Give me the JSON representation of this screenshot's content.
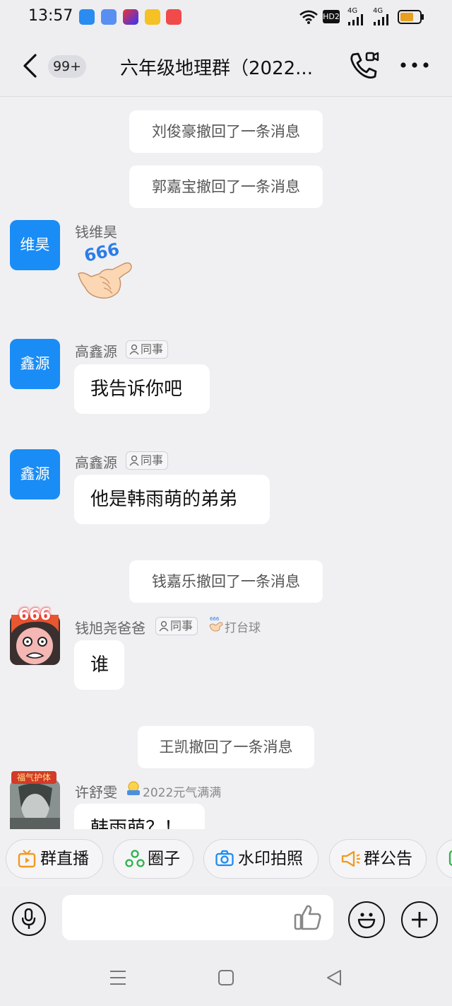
{
  "status_bar": {
    "time": "13:57",
    "hd_label": "HD2",
    "net1": "4G",
    "net2": "4G"
  },
  "header": {
    "back_badge": "99+",
    "title": "六年级地理群（2022..."
  },
  "messages": {
    "sys1": "刘俊豪撤回了一条消息",
    "sys2": "郭嘉宝撤回了一条消息",
    "m1": {
      "avatar": "维昊",
      "name": "钱维昊",
      "sticker": "666"
    },
    "m2": {
      "avatar": "鑫源",
      "name": "高鑫源",
      "tag": "同事",
      "text": "我告诉你吧"
    },
    "m3": {
      "avatar": "鑫源",
      "name": "高鑫源",
      "tag": "同事",
      "text": "他是韩雨萌的弟弟"
    },
    "sys3": "钱嘉乐撤回了一条消息",
    "m4": {
      "avatar_text": "666",
      "name": "钱旭尧爸爸",
      "tag": "同事",
      "title": "打台球",
      "text": "谁"
    },
    "sys4": "王凯撤回了一条消息",
    "m5": {
      "avatar_banner": "福气护体",
      "name": "许舒雯",
      "title": "2022元气满满",
      "text": "韩雨萌？！"
    }
  },
  "quick_actions": [
    "群直播",
    "圈子",
    "水印拍照",
    "群公告"
  ],
  "colors": {
    "accent": "#1a8cf5",
    "background": "#f0f0f3"
  }
}
